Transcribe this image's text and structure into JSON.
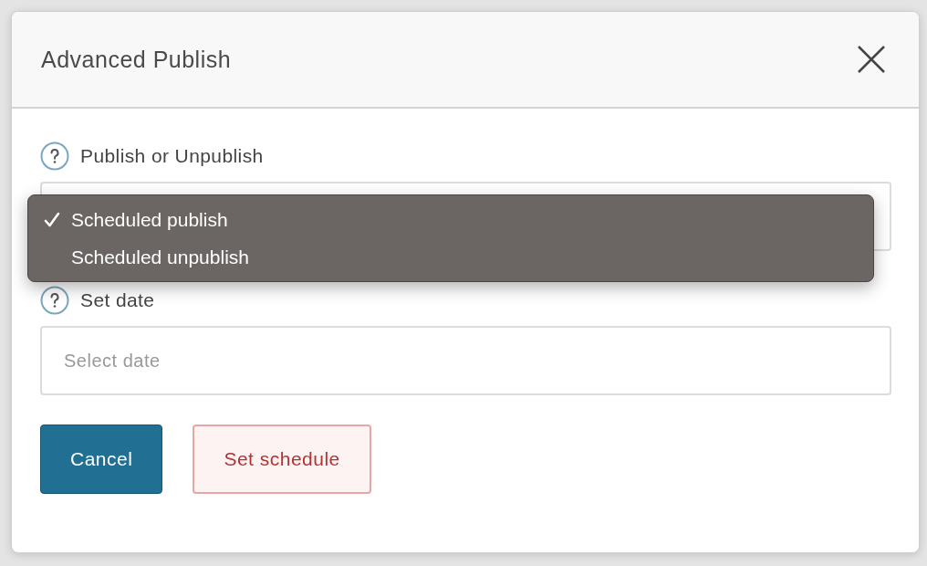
{
  "dialog": {
    "title": "Advanced Publish"
  },
  "publish_field": {
    "label": "Publish or Unpublish",
    "options": [
      {
        "label": "Scheduled publish",
        "selected": true
      },
      {
        "label": "Scheduled unpublish",
        "selected": false
      }
    ]
  },
  "date_field": {
    "label": "Set date",
    "placeholder": "Select date"
  },
  "buttons": [
    {
      "label": "Cancel",
      "kind": "primary"
    },
    {
      "label": "Set schedule",
      "kind": "danger"
    }
  ]
}
